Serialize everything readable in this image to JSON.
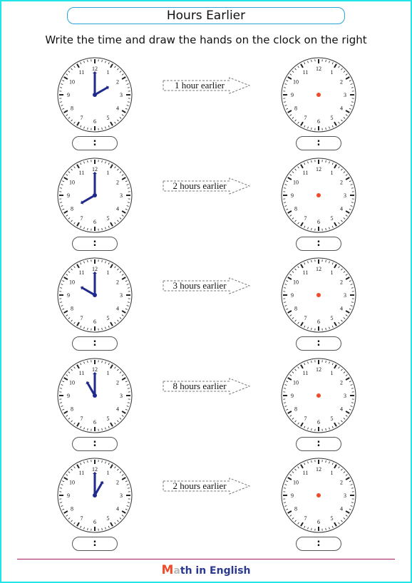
{
  "title": "Hours Earlier",
  "instructions": "Write the time and draw the hands on the clock on the right",
  "clock_numerals": [
    "12",
    "1",
    "2",
    "3",
    "4",
    "5",
    "6",
    "7",
    "8",
    "9",
    "10",
    "11"
  ],
  "time_placeholder": ":",
  "colors": {
    "frame": "#22e5e8",
    "title_border": "#2aa6d8",
    "hand": "#1f2a8c",
    "center_dot": "#f04b2b",
    "footer_line": "#a3195b"
  },
  "rows": [
    {
      "clock_time": {
        "hour": 2,
        "minute": 0
      },
      "instruction_label": "1 hour earlier"
    },
    {
      "clock_time": {
        "hour": 8,
        "minute": 0
      },
      "instruction_label": "2 hours earlier"
    },
    {
      "clock_time": {
        "hour": 10,
        "minute": 0
      },
      "instruction_label": "3 hours earlier"
    },
    {
      "clock_time": {
        "hour": 11,
        "minute": 0
      },
      "instruction_label": "8 hours earlier"
    },
    {
      "clock_time": {
        "hour": 1,
        "minute": 0
      },
      "instruction_label": "2 hours earlier"
    }
  ],
  "footer": {
    "logo_m": "M",
    "logo_a": "a",
    "logo_rest": "th in English"
  }
}
